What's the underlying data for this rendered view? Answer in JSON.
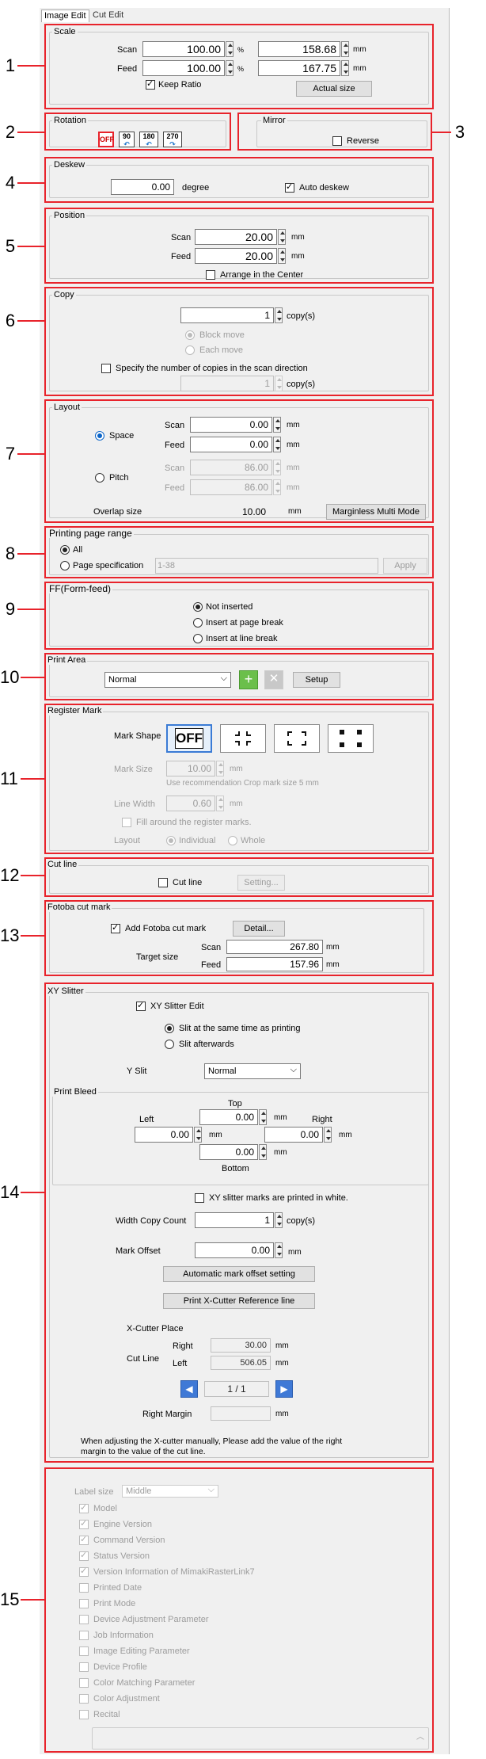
{
  "tabs": [
    "Image Edit",
    "Cut Edit"
  ],
  "scale": {
    "title": "Scale",
    "scan_label": "Scan",
    "feed_label": "Feed",
    "scan_pct": "100.00",
    "feed_pct": "100.00",
    "pct_unit": "%",
    "scan_mm": "158.68",
    "feed_mm": "167.75",
    "mm_unit": "mm",
    "keep_ratio": "Keep Ratio",
    "actual_size": "Actual size"
  },
  "rotation": {
    "title": "Rotation",
    "buttons": [
      "OFF",
      "90",
      "180",
      "270"
    ]
  },
  "mirror": {
    "title": "Mirror",
    "reverse": "Reverse"
  },
  "deskew": {
    "title": "Deskew",
    "value": "0.00",
    "unit": "degree",
    "auto": "Auto deskew"
  },
  "position": {
    "title": "Position",
    "scan_label": "Scan",
    "feed_label": "Feed",
    "scan": "20.00",
    "feed": "20.00",
    "unit": "mm",
    "center": "Arrange in the Center"
  },
  "copy": {
    "title": "Copy",
    "count": "1",
    "unit": "copy(s)",
    "block": "Block move",
    "each": "Each move",
    "specify": "Specify the number of copies in the scan direction",
    "scan_count": "1",
    "scan_unit": "copy(s)"
  },
  "layout": {
    "title": "Layout",
    "space": "Space",
    "pitch": "Pitch",
    "scan_label": "Scan",
    "feed_label": "Feed",
    "space_scan": "0.00",
    "space_feed": "0.00",
    "pitch_scan": "86.00",
    "pitch_feed": "86.00",
    "unit": "mm",
    "overlap_label": "Overlap size",
    "overlap": "10.00",
    "overlap_unit": "mm",
    "marginless": "Marginless Multi Mode"
  },
  "printing_range": {
    "title": "Printing page range",
    "all": "All",
    "spec": "Page specification",
    "spec_value": "1-38",
    "apply": "Apply"
  },
  "ff": {
    "title": "FF(Form-feed)",
    "opts": [
      "Not inserted",
      "Insert at page break",
      "Insert at line break"
    ]
  },
  "print_area": {
    "title": "Print Area",
    "value": "Normal",
    "setup": "Setup"
  },
  "register": {
    "title": "Register Mark",
    "shape_label": "Mark Shape",
    "off": "OFF",
    "size_label": "Mark Size",
    "size": "10.00",
    "unit": "mm",
    "recommend": "Use recommendation Crop mark size  5 mm",
    "width_label": "Line Width",
    "width": "0.60",
    "fill": "Fill around the register marks.",
    "layout_label": "Layout",
    "individual": "Individual",
    "whole": "Whole"
  },
  "cutline": {
    "title": "Cut line",
    "check": "Cut line",
    "setting": "Setting..."
  },
  "fotoba": {
    "title": "Fotoba cut mark",
    "add": "Add Fotoba cut mark",
    "detail": "Detail...",
    "target": "Target size",
    "scan_label": "Scan",
    "feed_label": "Feed",
    "scan": "267.80",
    "feed": "157.96",
    "unit": "mm"
  },
  "xy": {
    "title": "XY Slitter",
    "edit": "XY Slitter Edit",
    "same": "Slit at the same time as printing",
    "after": "Slit afterwards",
    "yslit_label": "Y Slit",
    "yslit": "Normal",
    "bleed": "Print Bleed",
    "top": "Top",
    "left": "Left",
    "right": "Right",
    "bottom": "Bottom",
    "top_v": "0.00",
    "left_v": "0.00",
    "right_v": "0.00",
    "bottom_v": "0.00",
    "unit": "mm",
    "white": "XY slitter marks are printed in white.",
    "wcc_label": "Width Copy Count",
    "wcc": "1",
    "wcc_unit": "copy(s)",
    "offset_label": "Mark Offset",
    "offset": "0.00",
    "auto_offset": "Automatic mark offset setting",
    "print_ref": "Print X-Cutter Reference line",
    "place": "X-Cutter Place",
    "cut_line": "Cut Line",
    "right_label": "Right",
    "left_label": "Left",
    "right_cut": "30.00",
    "left_cut": "506.05",
    "page": "1 / 1",
    "rmargin": "Right Margin",
    "note1": "When adjusting the X-cutter manually, Please add the value of the right",
    "note2": "margin to the value of the cut line."
  },
  "label": {
    "size_label": "Label size",
    "size": "Middle",
    "items": [
      {
        "t": "Model",
        "c": true
      },
      {
        "t": "Engine Version",
        "c": true
      },
      {
        "t": "Command Version",
        "c": true
      },
      {
        "t": "Status Version",
        "c": true
      },
      {
        "t": "Version Information of MimakiRasterLink7",
        "c": true
      },
      {
        "t": "Printed Date",
        "c": false
      },
      {
        "t": "Print Mode",
        "c": false
      },
      {
        "t": "Device Adjustment Parameter",
        "c": false
      },
      {
        "t": "Job Information",
        "c": false
      },
      {
        "t": "Image Editing Parameter",
        "c": false
      },
      {
        "t": "Device Profile",
        "c": false
      },
      {
        "t": "Color Matching Parameter",
        "c": false
      },
      {
        "t": "Color Adjustment",
        "c": false
      },
      {
        "t": "Recital",
        "c": false
      }
    ]
  },
  "numbers": [
    "1",
    "2",
    "3",
    "4",
    "5",
    "6",
    "7",
    "8",
    "9",
    "10",
    "11",
    "12",
    "13",
    "14",
    "15"
  ]
}
